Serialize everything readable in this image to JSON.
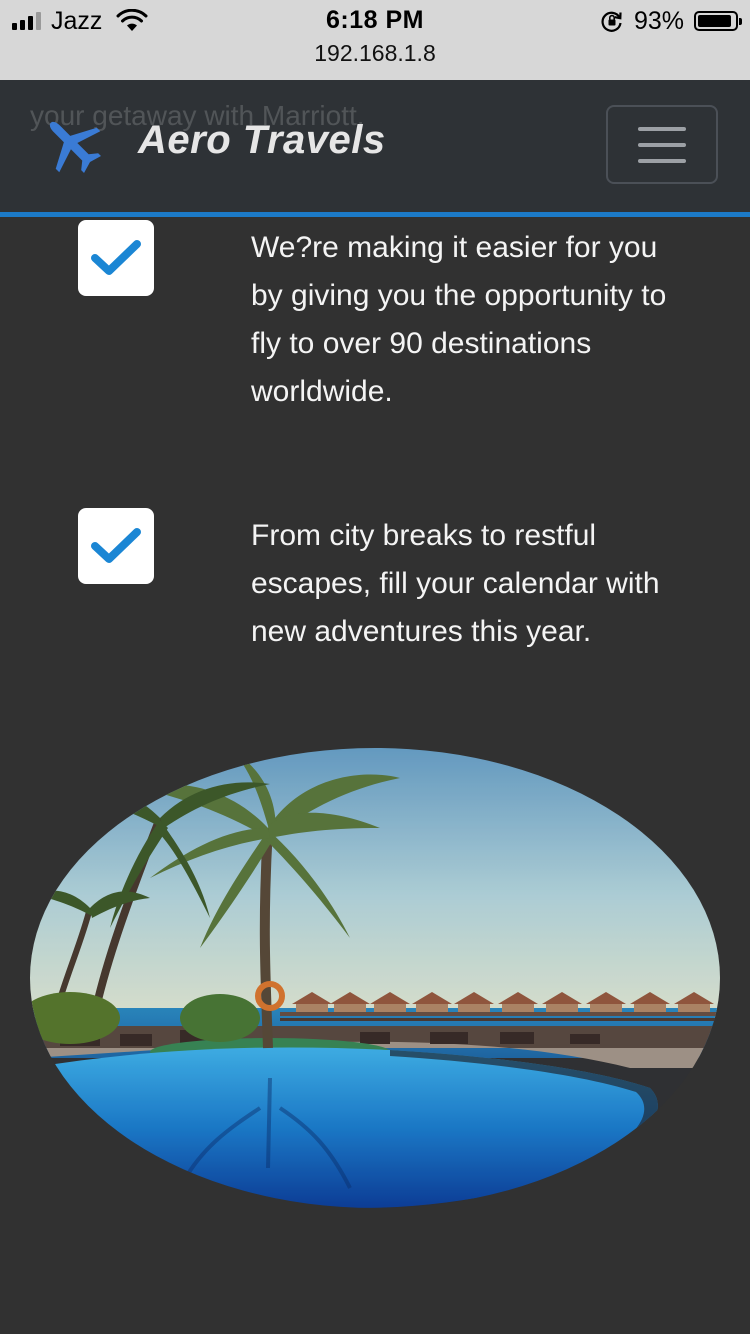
{
  "status_bar": {
    "carrier": "Jazz",
    "time": "6:18 PM",
    "url": "192.168.1.8",
    "battery_percent": "93%",
    "battery_level": 0.93,
    "icons": [
      "signal-icon",
      "wifi-icon",
      "lock-rotation-icon",
      "battery-icon"
    ]
  },
  "navbar": {
    "brand": "Aero Travels",
    "brand_icon": "plane-icon",
    "menu_icon": "hamburger-icon",
    "background_text_line2": "your getaway with Marriott."
  },
  "features": [
    {
      "icon": "check-icon",
      "text": "We?re making it easier for you by giving you the opportunity to fly to over 90 destinations worldwide."
    },
    {
      "icon": "check-icon",
      "text": "From city breaks to restful escapes, fill your calendar with new adventures this year."
    }
  ],
  "image": {
    "subject": "resort-pool-image"
  },
  "colors": {
    "page_background": "#313131",
    "navbar_background": "#2e3236",
    "accent": "#1c7ac7",
    "check_color": "#1b86d4",
    "text": "#f4f4f4"
  }
}
